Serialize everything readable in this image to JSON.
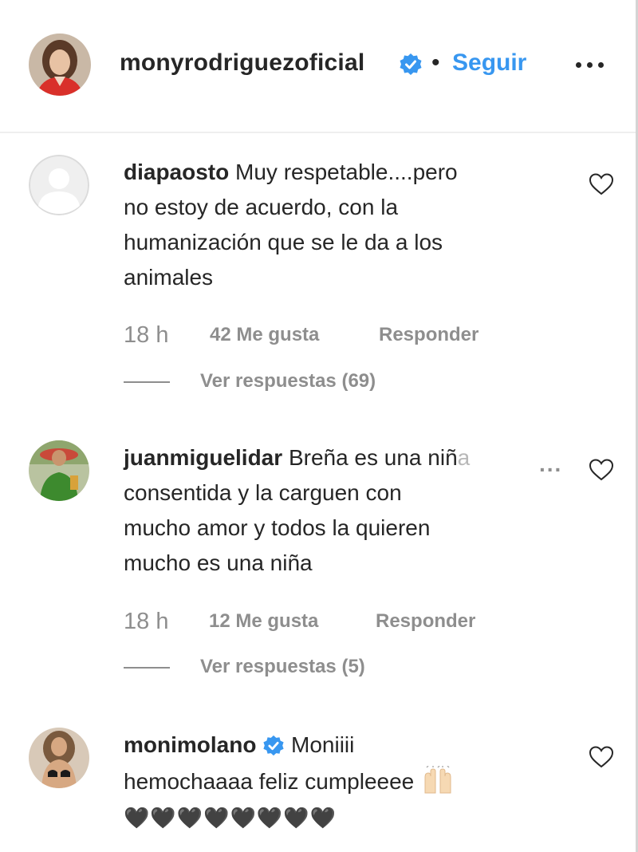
{
  "post": {
    "owner_username": "monyrodriguezoficial",
    "separator": "•",
    "follow_label": "Seguir",
    "more_icon": "more-options-icon"
  },
  "comments": [
    {
      "username": "diapaosto",
      "text": "Muy respetable....pero no estoy de acuerdo, con la humanización que se le da a los animales",
      "lines": [
        "Muy respetable....pero",
        "no estoy de acuerdo, con la",
        "humanización que se le da a los",
        "animales"
      ],
      "time": "18 h",
      "likes": "42 Me gusta",
      "reply_label": "Responder",
      "view_replies": "Ver respuestas (69)"
    },
    {
      "username": "juanmiguelidar",
      "line1_visible": "Breña es una niñ",
      "line1_faded": "a",
      "more": "...",
      "lines": [
        "consentida y la carguen con",
        "mucho amor y todos la quieren",
        "mucho es una niña"
      ],
      "time": "18 h",
      "likes": "12 Me gusta",
      "reply_label": "Responder",
      "view_replies": "Ver respuestas (5)"
    },
    {
      "username": "monimolano",
      "verified": true,
      "line1": "Moniiii",
      "line2": "hemochaaaa feliz cumpleeee",
      "line3": "🖤🖤🖤🖤🖤🖤🖤🖤"
    }
  ],
  "colors": {
    "link_blue": "#3897f0",
    "verified_blue": "#3897f0",
    "secondary_text": "#8e8e8e",
    "primary_text": "#262626"
  }
}
